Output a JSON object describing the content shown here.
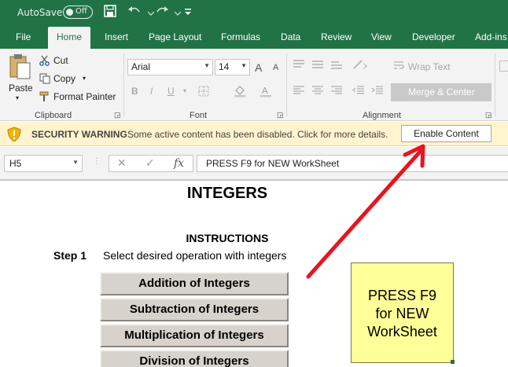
{
  "titlebar": {
    "autosave_label": "AutoSave",
    "autosave_state": "Off"
  },
  "tabs": [
    {
      "label": "File"
    },
    {
      "label": "Home"
    },
    {
      "label": "Insert"
    },
    {
      "label": "Page Layout"
    },
    {
      "label": "Formulas"
    },
    {
      "label": "Data"
    },
    {
      "label": "Review"
    },
    {
      "label": "View"
    },
    {
      "label": "Developer"
    },
    {
      "label": "Add-ins"
    }
  ],
  "clipboard": {
    "paste_label": "Paste",
    "cut_label": "Cut",
    "copy_label": "Copy",
    "format_painter_label": "Format Painter",
    "group_label": "Clipboard"
  },
  "font": {
    "font_name": "Arial",
    "font_size": "14",
    "group_label": "Font",
    "bold_label": "B",
    "italic_label": "I",
    "underline_label": "U",
    "grow_label": "A",
    "shrink_label": "A"
  },
  "alignment": {
    "wrap_text_label": "Wrap Text",
    "merge_center_label": "Merge & Center",
    "group_label": "Alignment"
  },
  "security": {
    "title": "SECURITY WARNING",
    "message": "Some active content has been disabled. Click for more details.",
    "button_label": "Enable Content"
  },
  "formula_bar": {
    "name_box": "H5",
    "cancel_glyph": "✕",
    "enter_glyph": "✓",
    "fx_glyph": "fx",
    "formula": "PRESS F9 for NEW WorkSheet"
  },
  "sheet": {
    "title": "INTEGERS",
    "instructions": "INSTRUCTIONS",
    "step_label": "Step 1",
    "step_text": "Select desired operation with integers",
    "operations": [
      {
        "label": "Addition of Integers"
      },
      {
        "label": "Subtraction of Integers"
      },
      {
        "label": "Multiplication of Integers"
      },
      {
        "label": "Division of Integers"
      }
    ],
    "note_lines": [
      "PRESS F9",
      "for NEW",
      "WorkSheet"
    ]
  },
  "colors": {
    "excel_green": "#217346",
    "warning_bar": "#fff4ce",
    "note_yellow": "#ffff99",
    "arrow_red": "#e8141e"
  }
}
